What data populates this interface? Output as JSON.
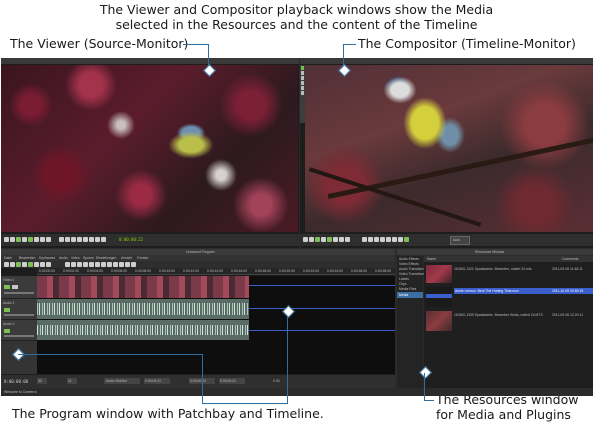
{
  "annotations": {
    "top_line1": "The Viewer and Compositor playback windows show the Media",
    "top_line2": "selected in the Resources and the content of the Timeline",
    "viewer": "The Viewer (Source-Monitor)",
    "compositor": "The Compositor (Timeline-Monitor)",
    "program": "The Program window with Patchbay and Timeline.",
    "resources_line1": "The Resources window",
    "resources_line2": "for Media and Plugins"
  },
  "viewer": {
    "timecode": "0:00:00:22"
  },
  "compositor": {
    "zoom": "Auto"
  },
  "program": {
    "title": "Unnamed Program",
    "menu": [
      "Datei",
      "Bearbeiten",
      "Keyframes",
      "Audio",
      "Video",
      "Spuren",
      "Einstellungen",
      "Ansicht",
      "Fenster"
    ],
    "ruler": [
      "0:00:00:00",
      "0:00:02:00",
      "0:00:04:00",
      "0:00:06:00",
      "0:00:08:00",
      "0:00:10:00",
      "0:00:12:00",
      "0:00:14:00",
      "0:00:16:00",
      "0:00:18:00",
      "0:00:20:00",
      "0:00:22:00",
      "0:00:24:00",
      "0:00:26:00",
      "0:00:28:00"
    ],
    "tracks": [
      "Video 1",
      "Audio 1",
      "Audio 2"
    ],
    "status_left": "0:00:00:00",
    "status_fields": [
      "30",
      "11",
      "Audio Monitor",
      "0:00:04:22",
      "0:00:00:00",
      "0:00:00:22"
    ],
    "status_zoom": "0.00"
  },
  "resources": {
    "title": "Resources Window",
    "folders": [
      "Audio Effects",
      "Video Effects",
      "Audio Transitions",
      "Video Transitions",
      "Labels",
      "Clips",
      "Media Files",
      "Media"
    ],
    "columns": [
      "Name",
      "Comments"
    ],
    "items": [
      {
        "name": "110400-1321 Sparkstarke, Bewerber, notiert 23.mts",
        "date": "2011-09-06 11:48:11"
      },
      {
        "name": "Annie Lennox: Bent The Hurting Time.mov",
        "date": "2011-10-09 00:55:19"
      },
      {
        "name": "110400-1330 Sparkstarke, Bewerber Kinds, notiert 24.MTS",
        "date": "2011-09-06 12:20:11"
      }
    ]
  },
  "footer": {
    "status": "Welcome to Cinelerra"
  },
  "colors": {
    "timecode": "#8fd400",
    "audio_wave": "#9fb8a8",
    "selection": "#3a5fcd",
    "connector": "#2f6fa0"
  }
}
